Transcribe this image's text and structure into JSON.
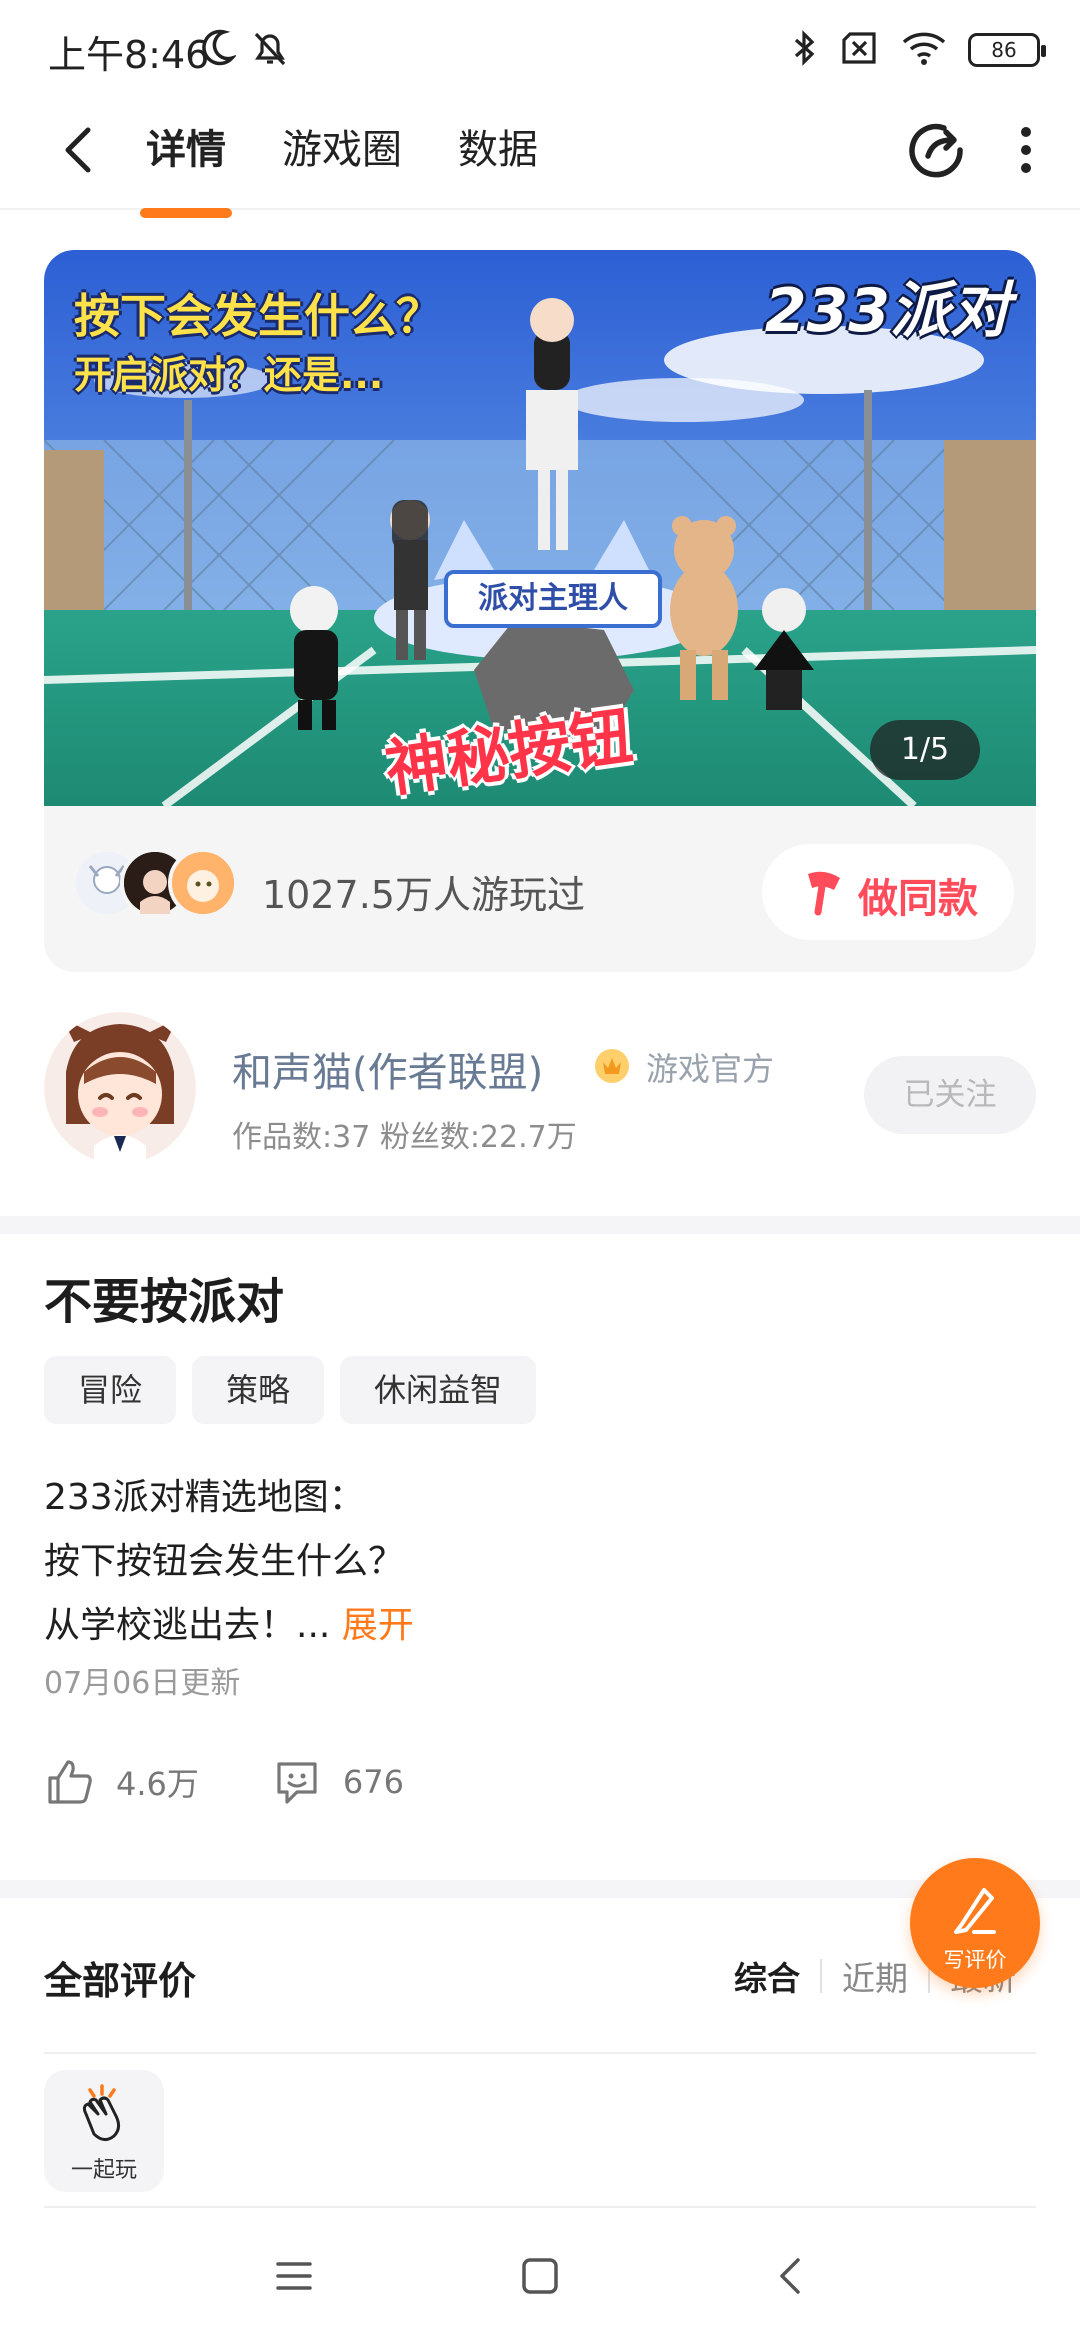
{
  "status_bar": {
    "time": "上午8:46",
    "battery": "86",
    "icons": [
      "moon-icon",
      "mute-icon",
      "bluetooth-icon",
      "sim-off-icon",
      "wifi-icon",
      "battery-icon"
    ]
  },
  "top_nav": {
    "tabs": [
      {
        "label": "详情",
        "active": true
      },
      {
        "label": "游戏圈",
        "active": false
      },
      {
        "label": "数据",
        "active": false
      }
    ]
  },
  "banner": {
    "headline": "按下会发生什么？",
    "subline": "开启派对？还是...",
    "brand": "233派对",
    "sign": "派对主理人",
    "mystery": "神秘按钮",
    "counter": "1/5"
  },
  "played": {
    "text": "1027.5万人游玩过",
    "same_button": "做同款"
  },
  "author": {
    "name": "和声猫(作者联盟)",
    "badge": "游戏官方",
    "stats": "作品数:37   粉丝数:22.7万",
    "follow": "已关注"
  },
  "game": {
    "title": "不要按派对",
    "tags": [
      "冒险",
      "策略",
      "休闲益智"
    ],
    "desc_lines": [
      "233派对精选地图：",
      "按下按钮会发生什么？",
      "从学校逃出去！..."
    ],
    "expand": "展开",
    "updated": "07月06日更新",
    "likes": "4.6万",
    "comments": "676"
  },
  "reviews": {
    "title": "全部评价",
    "sort": [
      "综合",
      "近期",
      "最新"
    ],
    "chip": "一起玩",
    "fab": "写评价"
  },
  "colors": {
    "accent": "#ff7a1a",
    "same_btn": "#ff4b5a",
    "author_name": "#687a94"
  }
}
